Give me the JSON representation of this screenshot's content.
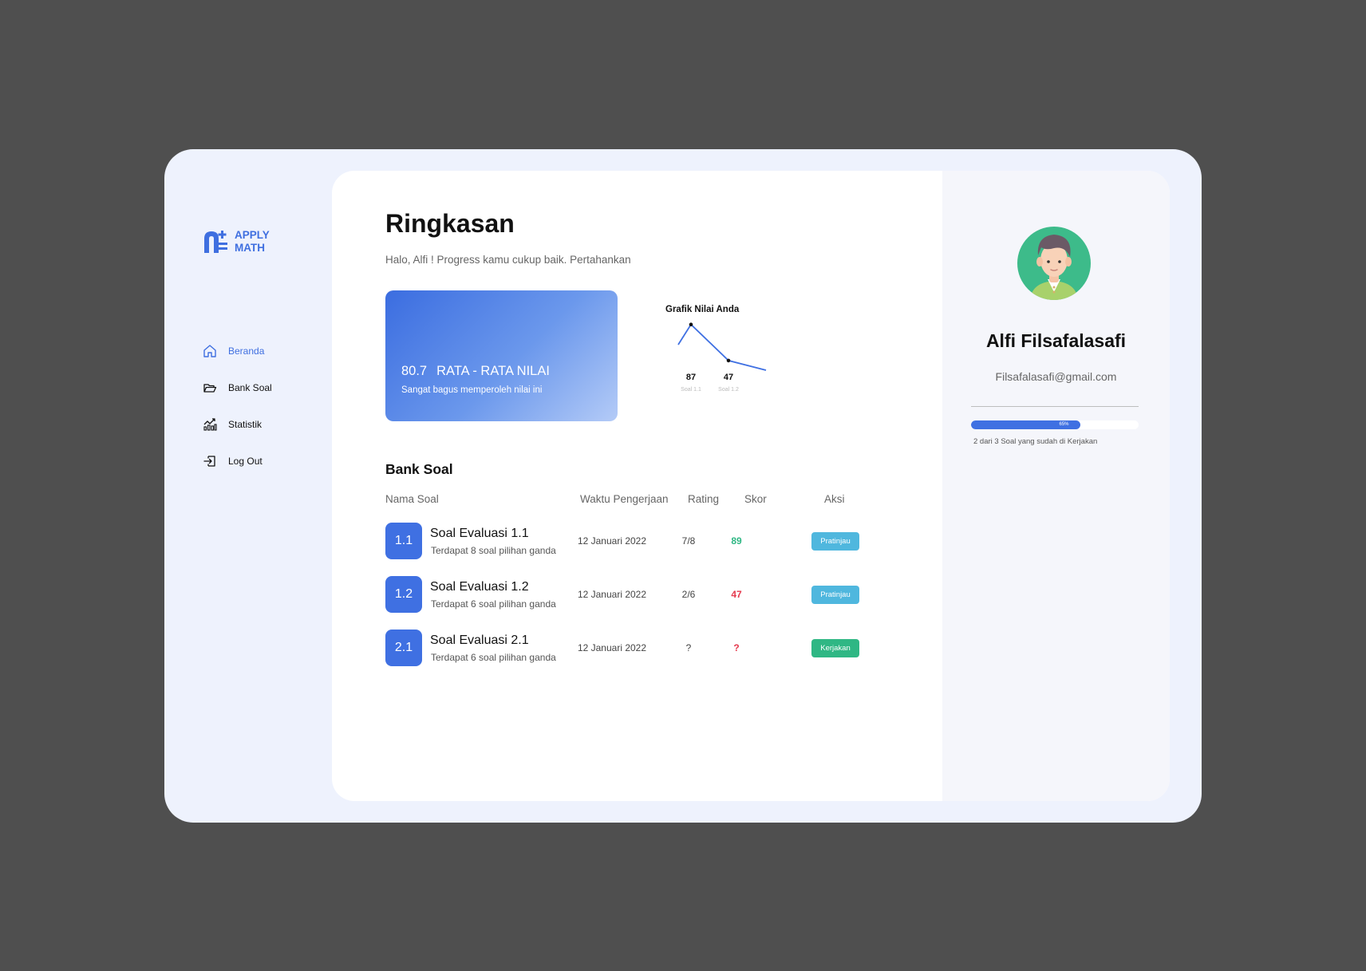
{
  "app": {
    "logo_line1": "APPLY",
    "logo_line2": "MATH"
  },
  "sidebar": {
    "items": [
      {
        "label": "Beranda",
        "icon": "home-icon",
        "active": true
      },
      {
        "label": "Bank Soal",
        "icon": "folder-open-icon",
        "active": false
      },
      {
        "label": "Statistik",
        "icon": "chart-icon",
        "active": false
      },
      {
        "label": "Log Out",
        "icon": "logout-icon",
        "active": false
      }
    ]
  },
  "summary": {
    "title": "Ringkasan",
    "subtitle": "Halo, Alfi ! Progress kamu cukup baik. Pertahankan",
    "average_value": "80.7",
    "average_label": "RATA - RATA NILAI",
    "average_desc": "Sangat bagus memperoleh nilai ini"
  },
  "chart": {
    "title": "Grafik Nilai Anda",
    "colors": {
      "line": "#3f70e2"
    }
  },
  "chart_data": {
    "type": "line",
    "title": "Grafik Nilai Anda",
    "categories": [
      "Soal 1.1",
      "Soal 1.2"
    ],
    "values": [
      87,
      47
    ],
    "data_labels": [
      "87",
      "47"
    ]
  },
  "bank": {
    "title": "Bank Soal",
    "headers": {
      "name": "Nama Soal",
      "time": "Waktu Pengerjaan",
      "rating": "Rating",
      "score": "Skor",
      "action": "Aksi"
    },
    "rows": [
      {
        "badge": "1.1",
        "title": "Soal Evaluasi 1.1",
        "sub": "Terdapat 8 soal pilihan ganda",
        "date": "12 Januari 2022",
        "rating": "7/8",
        "score": "89",
        "score_color": "#2fb784",
        "action": "Pratinjau",
        "action_color": "#4fb7de"
      },
      {
        "badge": "1.2",
        "title": "Soal Evaluasi 1.2",
        "sub": "Terdapat 6 soal pilihan ganda",
        "date": "12 Januari 2022",
        "rating": "2/6",
        "score": "47",
        "score_color": "#e53a4e",
        "action": "Pratinjau",
        "action_color": "#4fb7de"
      },
      {
        "badge": "2.1",
        "title": "Soal Evaluasi 2.1",
        "sub": "Terdapat 6 soal pilihan ganda",
        "date": "12 Januari 2022",
        "rating": "?",
        "score": "?",
        "score_color": "#e53a4e",
        "action": "Kerjakan",
        "action_color": "#2fb784"
      }
    ]
  },
  "profile": {
    "name": "Alfi Filsafalasafi",
    "email": "Filsafalasafi@gmail.com",
    "progress_percent": 65,
    "progress_label": "65%",
    "progress_text": "2 dari 3 Soal yang sudah di Kerjakan",
    "avatar_icon": "user-avatar-icon"
  },
  "colors": {
    "accent": "#3f70e2",
    "background": "#4f4f4f",
    "frame": "#eef2fd"
  }
}
